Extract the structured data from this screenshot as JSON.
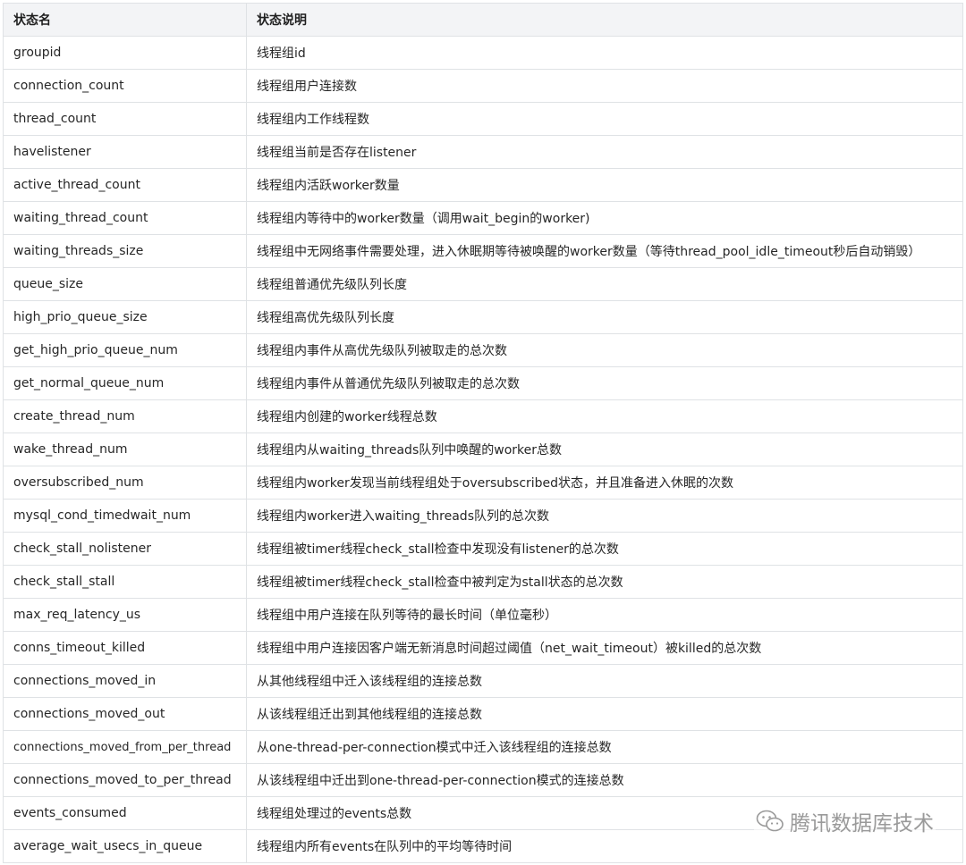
{
  "table": {
    "headers": [
      "状态名",
      "状态说明"
    ],
    "rows": [
      [
        "groupid",
        "线程组id"
      ],
      [
        "connection_count",
        "线程组用户连接数"
      ],
      [
        "thread_count",
        "线程组内工作线程数"
      ],
      [
        "havelistener",
        "线程组当前是否存在listener"
      ],
      [
        "active_thread_count",
        "线程组内活跃worker数量"
      ],
      [
        "waiting_thread_count",
        "线程组内等待中的worker数量（调用wait_begin的worker)"
      ],
      [
        "waiting_threads_size",
        "线程组中无网络事件需要处理，进入休眠期等待被唤醒的worker数量（等待thread_pool_idle_timeout秒后自动销毁）"
      ],
      [
        "queue_size",
        "线程组普通优先级队列长度"
      ],
      [
        "high_prio_queue_size",
        "线程组高优先级队列长度"
      ],
      [
        "get_high_prio_queue_num",
        "线程组内事件从高优先级队列被取走的总次数"
      ],
      [
        "get_normal_queue_num",
        "线程组内事件从普通优先级队列被取走的总次数"
      ],
      [
        "create_thread_num",
        "线程组内创建的worker线程总数"
      ],
      [
        "wake_thread_num",
        "线程组内从waiting_threads队列中唤醒的worker总数"
      ],
      [
        "oversubscribed_num",
        "线程组内worker发现当前线程组处于oversubscribed状态，并且准备进入休眠的次数"
      ],
      [
        "mysql_cond_timedwait_num",
        "线程组内worker进入waiting_threads队列的总次数"
      ],
      [
        "check_stall_nolistener",
        "线程组被timer线程check_stall检查中发现没有listener的总次数"
      ],
      [
        "check_stall_stall",
        "线程组被timer线程check_stall检查中被判定为stall状态的总次数"
      ],
      [
        "max_req_latency_us",
        "线程组中用户连接在队列等待的最长时间（单位毫秒）"
      ],
      [
        "conns_timeout_killed",
        "线程组中用户连接因客户端无新消息时间超过阈值（net_wait_timeout）被killed的总次数"
      ],
      [
        "connections_moved_in",
        "从其他线程组中迁入该线程组的连接总数"
      ],
      [
        "connections_moved_out",
        "从该线程组迁出到其他线程组的连接总数"
      ],
      [
        "connections_moved_from_per_thread",
        "从one-thread-per-connection模式中迁入该线程组的连接总数"
      ],
      [
        "connections_moved_to_per_thread",
        "从该线程组中迁出到one-thread-per-connection模式的连接总数"
      ],
      [
        "events_consumed",
        "线程组处理过的events总数"
      ],
      [
        "average_wait_usecs_in_queue",
        "线程组内所有events在队列中的平均等待时间"
      ]
    ]
  },
  "watermark": {
    "text": "腾讯数据库技术",
    "icon": "wechat-icon"
  }
}
